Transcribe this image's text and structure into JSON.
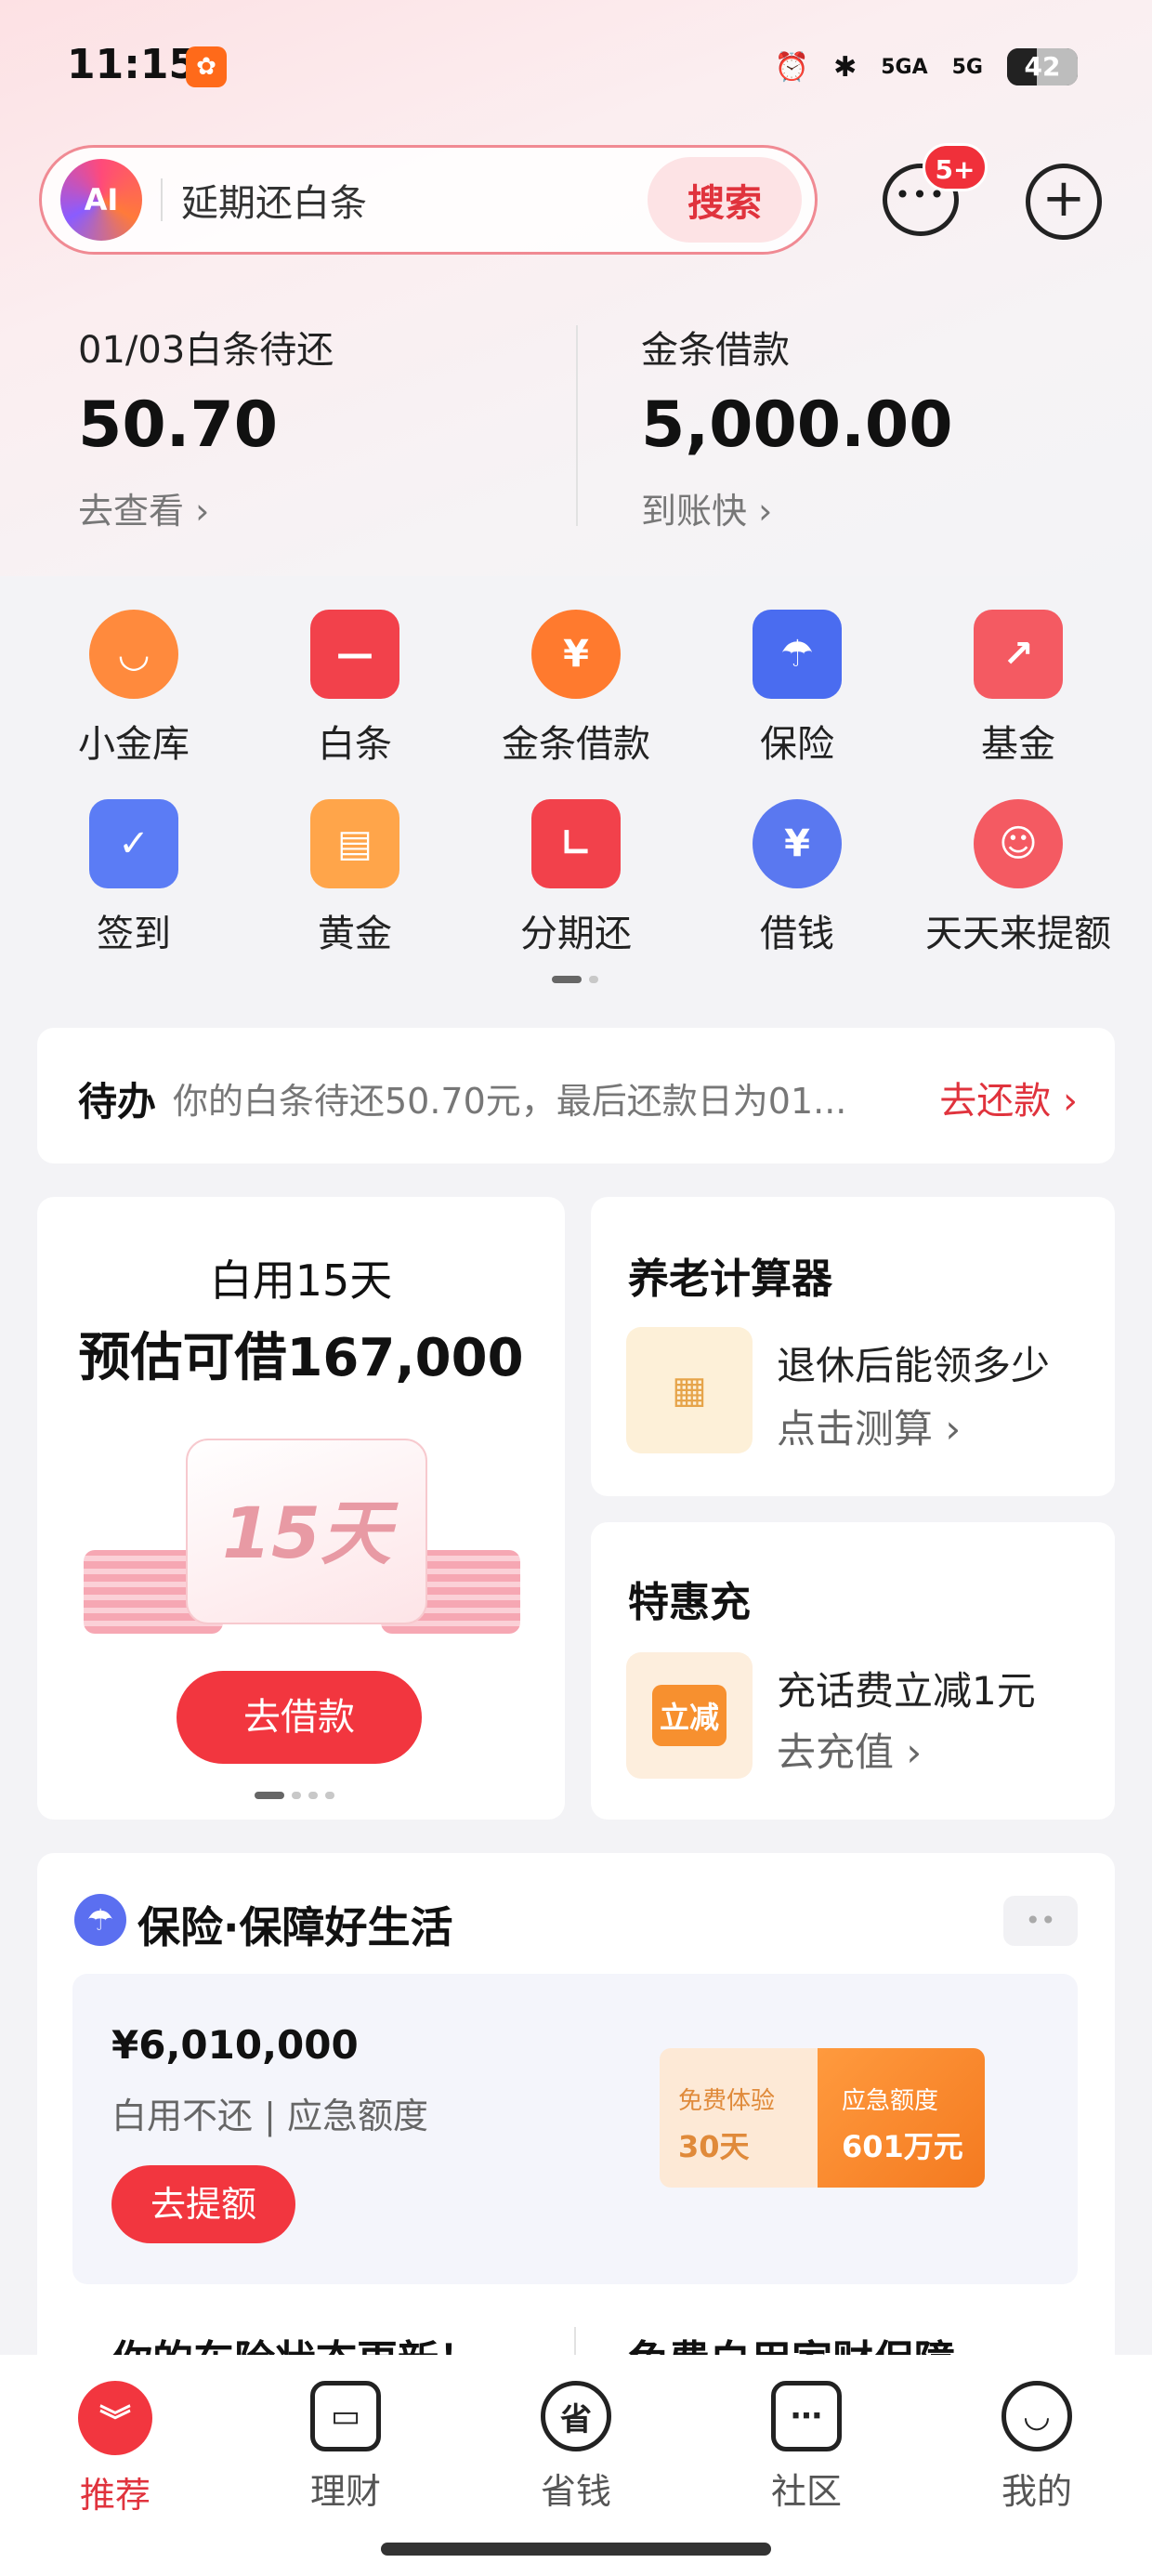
{
  "status_bar": {
    "time": "11:15",
    "app_icon": "tao-app-icon",
    "signal_1": "5GA",
    "signal_2": "5G",
    "battery": "42"
  },
  "search": {
    "ai_label": "AI",
    "query": "延期还白条",
    "button_label": "搜索",
    "message_badge": "5+"
  },
  "balances": {
    "left": {
      "label": "01/03白条待还",
      "amount": "50.70",
      "link": "去查看 ›"
    },
    "right": {
      "label": "金条借款",
      "amount": "5,000.00",
      "link": "到账快 ›"
    }
  },
  "grid": [
    {
      "label": "小金库",
      "icon": "piggy-bag-icon",
      "color": "#ff8a3d"
    },
    {
      "label": "白条",
      "icon": "white-bill-icon",
      "color": "#f2414b"
    },
    {
      "label": "金条借款",
      "icon": "yuan-coin-icon",
      "color": "#ff7a2e"
    },
    {
      "label": "保险",
      "icon": "umbrella-shield-icon",
      "color": "#4a6cf0"
    },
    {
      "label": "基金",
      "icon": "fund-chart-icon",
      "color": "#f45a62"
    },
    {
      "label": "签到",
      "icon": "calendar-check-icon",
      "color": "#5b7cf5"
    },
    {
      "label": "黄金",
      "icon": "gold-bars-icon",
      "color": "#ffa54a"
    },
    {
      "label": "分期还",
      "icon": "installment-icon",
      "color": "#f2414b"
    },
    {
      "label": "借钱",
      "icon": "money-bag-icon",
      "color": "#5a78f0"
    },
    {
      "label": "天天来提额",
      "icon": "mascot-icon",
      "color": "#f45a62"
    }
  ],
  "todo": {
    "title": "待办",
    "text": "你的白条待还50.70元，最后还款日为01...",
    "link": "去还款 ›"
  },
  "loan_card": {
    "subtitle": "白用15天",
    "headline": "预估可借167,000",
    "tag": "15天",
    "button": "去借款"
  },
  "pension_card": {
    "title": "养老计算器",
    "main": "退休后能领多少",
    "sub": "点击测算 ›"
  },
  "topup_card": {
    "title": "特惠充",
    "main": "充话费立减1元",
    "sub": "去充值 ›",
    "badge": "立减"
  },
  "insurance": {
    "title": "保险·保障好生活",
    "amount": "¥6,010,000",
    "desc": "白用不还 | 应急额度",
    "button": "去提额",
    "promo_left_label": "免费体验",
    "promo_left_value": "30天",
    "promo_right_label": "应急额度",
    "promo_right_value": "601万元",
    "peek_left": "你的车险状态更新！",
    "peek_right": "免费白用家财保障"
  },
  "tabs": [
    {
      "label": "推荐",
      "icon": "double-chevron-down-icon",
      "active": true
    },
    {
      "label": "理财",
      "icon": "wallet-icon",
      "active": false
    },
    {
      "label": "省钱",
      "icon": "save-money-icon",
      "active": false
    },
    {
      "label": "社区",
      "icon": "chat-icon",
      "active": false
    },
    {
      "label": "我的",
      "icon": "smile-icon",
      "active": false
    }
  ]
}
